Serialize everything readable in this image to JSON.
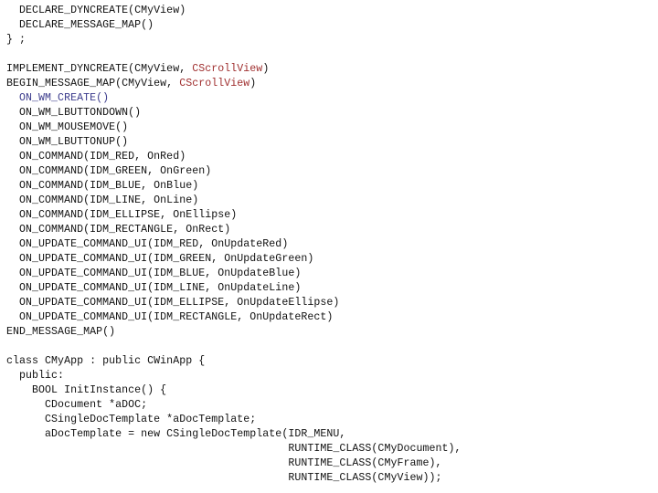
{
  "document": {
    "kind": "source-code-listing",
    "language": "C++",
    "background_color": "#ffffff",
    "colors": {
      "plain": "#111111",
      "blue": "#3b3b8c",
      "red": "#a03030"
    }
  },
  "lines": [
    {
      "id": 1,
      "indent": 2,
      "tokens": [
        {
          "t": "DECLARE_DYNCREATE(CMyView)",
          "c": "plain"
        }
      ]
    },
    {
      "id": 2,
      "indent": 2,
      "tokens": [
        {
          "t": "DECLARE_MESSAGE_MAP()",
          "c": "plain"
        }
      ]
    },
    {
      "id": 3,
      "indent": 0,
      "tokens": [
        {
          "t": "} ;",
          "c": "plain"
        }
      ]
    },
    {
      "id": 4,
      "indent": 0,
      "tokens": [
        {
          "t": "",
          "c": "plain"
        }
      ]
    },
    {
      "id": 5,
      "indent": 0,
      "tokens": [
        {
          "t": "IMPLEMENT_DYNCREATE(CMyView, ",
          "c": "plain"
        },
        {
          "t": "CScrollView",
          "c": "red"
        },
        {
          "t": ")",
          "c": "plain"
        }
      ]
    },
    {
      "id": 6,
      "indent": 0,
      "tokens": [
        {
          "t": "BEGIN_MESSAGE_MAP(CMyView, ",
          "c": "plain"
        },
        {
          "t": "CScrollView",
          "c": "red"
        },
        {
          "t": ")",
          "c": "plain"
        }
      ]
    },
    {
      "id": 7,
      "indent": 2,
      "tokens": [
        {
          "t": "ON_WM_CREATE()",
          "c": "blue"
        }
      ]
    },
    {
      "id": 8,
      "indent": 2,
      "tokens": [
        {
          "t": "ON_WM_LBUTTONDOWN()",
          "c": "plain"
        }
      ]
    },
    {
      "id": 9,
      "indent": 2,
      "tokens": [
        {
          "t": "ON_WM_MOUSEMOVE()",
          "c": "plain"
        }
      ]
    },
    {
      "id": 10,
      "indent": 2,
      "tokens": [
        {
          "t": "ON_WM_LBUTTONUP()",
          "c": "plain"
        }
      ]
    },
    {
      "id": 11,
      "indent": 2,
      "tokens": [
        {
          "t": "ON_COMMAND(IDM_RED, OnRed)",
          "c": "plain"
        }
      ]
    },
    {
      "id": 12,
      "indent": 2,
      "tokens": [
        {
          "t": "ON_COMMAND(IDM_GREEN, OnGreen)",
          "c": "plain"
        }
      ]
    },
    {
      "id": 13,
      "indent": 2,
      "tokens": [
        {
          "t": "ON_COMMAND(IDM_BLUE, OnBlue)",
          "c": "plain"
        }
      ]
    },
    {
      "id": 14,
      "indent": 2,
      "tokens": [
        {
          "t": "ON_COMMAND(IDM_LINE, OnLine)",
          "c": "plain"
        }
      ]
    },
    {
      "id": 15,
      "indent": 2,
      "tokens": [
        {
          "t": "ON_COMMAND(IDM_ELLIPSE, OnEllipse)",
          "c": "plain"
        }
      ]
    },
    {
      "id": 16,
      "indent": 2,
      "tokens": [
        {
          "t": "ON_COMMAND(IDM_RECTANGLE, OnRect)",
          "c": "plain"
        }
      ]
    },
    {
      "id": 17,
      "indent": 2,
      "tokens": [
        {
          "t": "ON_UPDATE_COMMAND_UI(IDM_RED, OnUpdateRed)",
          "c": "plain"
        }
      ]
    },
    {
      "id": 18,
      "indent": 2,
      "tokens": [
        {
          "t": "ON_UPDATE_COMMAND_UI(IDM_GREEN, OnUpdateGreen)",
          "c": "plain"
        }
      ]
    },
    {
      "id": 19,
      "indent": 2,
      "tokens": [
        {
          "t": "ON_UPDATE_COMMAND_UI(IDM_BLUE, OnUpdateBlue)",
          "c": "plain"
        }
      ]
    },
    {
      "id": 20,
      "indent": 2,
      "tokens": [
        {
          "t": "ON_UPDATE_COMMAND_UI(IDM_LINE, OnUpdateLine)",
          "c": "plain"
        }
      ]
    },
    {
      "id": 21,
      "indent": 2,
      "tokens": [
        {
          "t": "ON_UPDATE_COMMAND_UI(IDM_ELLIPSE, OnUpdateEllipse)",
          "c": "plain"
        }
      ]
    },
    {
      "id": 22,
      "indent": 2,
      "tokens": [
        {
          "t": "ON_UPDATE_COMMAND_UI(IDM_RECTANGLE, OnUpdateRect)",
          "c": "plain"
        }
      ]
    },
    {
      "id": 23,
      "indent": 0,
      "tokens": [
        {
          "t": "END_MESSAGE_MAP()",
          "c": "plain"
        }
      ]
    },
    {
      "id": 24,
      "indent": 0,
      "tokens": [
        {
          "t": "",
          "c": "plain"
        }
      ]
    },
    {
      "id": 25,
      "indent": 0,
      "tokens": [
        {
          "t": "class CMyApp : public CWinApp {",
          "c": "plain"
        }
      ]
    },
    {
      "id": 26,
      "indent": 2,
      "tokens": [
        {
          "t": "public:",
          "c": "plain"
        }
      ]
    },
    {
      "id": 27,
      "indent": 4,
      "tokens": [
        {
          "t": "BOOL InitInstance() {",
          "c": "plain"
        }
      ]
    },
    {
      "id": 28,
      "indent": 6,
      "tokens": [
        {
          "t": "CDocument *aDOC;",
          "c": "plain"
        }
      ]
    },
    {
      "id": 29,
      "indent": 6,
      "tokens": [
        {
          "t": "CSingleDocTemplate *aDocTemplate;",
          "c": "plain"
        }
      ]
    },
    {
      "id": 30,
      "indent": 6,
      "tokens": [
        {
          "t": "aDocTemplate = new CSingleDocTemplate(IDR_MENU,",
          "c": "plain"
        }
      ]
    },
    {
      "id": 31,
      "indent": 44,
      "tokens": [
        {
          "t": "RUNTIME_CLASS(CMyDocument),",
          "c": "plain"
        }
      ]
    },
    {
      "id": 32,
      "indent": 44,
      "tokens": [
        {
          "t": "RUNTIME_CLASS(CMyFrame),",
          "c": "plain"
        }
      ]
    },
    {
      "id": 33,
      "indent": 44,
      "tokens": [
        {
          "t": "RUNTIME_CLASS(CMyView));",
          "c": "plain"
        }
      ]
    }
  ]
}
